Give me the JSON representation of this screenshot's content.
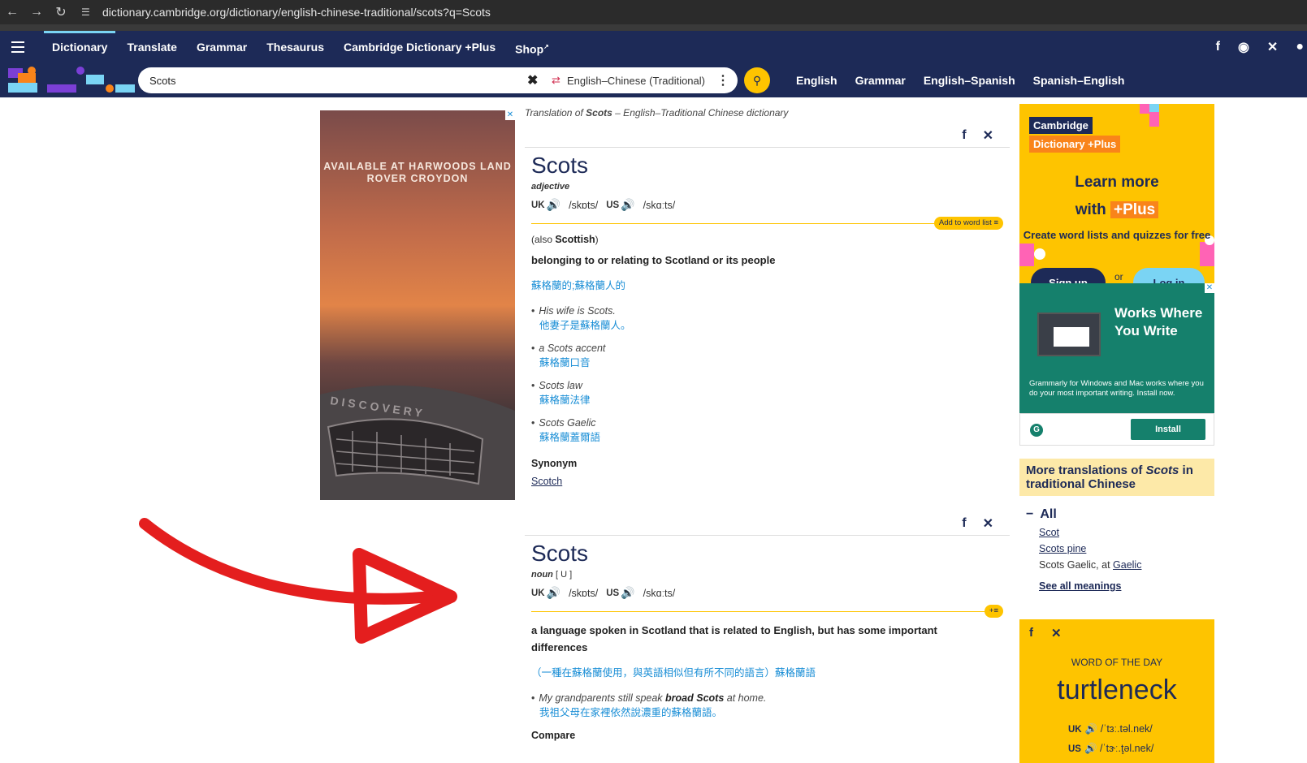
{
  "browser": {
    "url": "dictionary.cambridge.org/dictionary/english-chinese-traditional/scots?q=Scots"
  },
  "nav": {
    "items": [
      "Dictionary",
      "Translate",
      "Grammar",
      "Thesaurus",
      "Cambridge Dictionary +Plus",
      "Shop"
    ],
    "active": "Dictionary",
    "social": [
      "facebook-icon",
      "instagram-icon",
      "x-icon"
    ]
  },
  "search": {
    "query": "Scots",
    "dictionary": "English–Chinese (Traditional)",
    "quick_links": [
      "English",
      "Grammar",
      "English–Spanish",
      "Spanish–English"
    ]
  },
  "ad_left": {
    "text": "AVAILABLE AT HARWOODS LAND ROVER CROYDON",
    "brand": "DISCOVERY"
  },
  "entry": {
    "caption_prefix": "Translation of ",
    "caption_word": "Scots",
    "caption_suffix": " – English–Traditional Chinese dictionary",
    "blocks": [
      {
        "headword": "Scots",
        "pos": "adjective",
        "grammar": "",
        "uk_label": "UK",
        "uk_ipa": "/skɒts/",
        "us_label": "US",
        "us_ipa": "/skɑːts/",
        "wordlist_label": "Add to word list ≡",
        "also_prefix": "(also ",
        "also_word": "Scottish",
        "also_suffix": ")",
        "definition": "belonging to or relating to Scotland or its people",
        "translation": "蘇格蘭的;蘇格蘭人的",
        "examples": [
          {
            "text": "His wife is Scots.",
            "trans": "他妻子是蘇格蘭人。"
          },
          {
            "text": "a Scots accent",
            "trans": "蘇格蘭口音"
          },
          {
            "text": "Scots law",
            "trans": "蘇格蘭法律"
          },
          {
            "text": "Scots Gaelic",
            "trans": "蘇格蘭蓋爾語"
          }
        ],
        "synonym_heading": "Synonym",
        "synonym": "Scotch"
      },
      {
        "headword": "Scots",
        "pos": "noun",
        "grammar": "[ U ]",
        "uk_label": "UK",
        "uk_ipa": "/skɒts/",
        "us_label": "US",
        "us_ipa": "/skɑːts/",
        "wordlist_label": "+≡",
        "definition": "a language spoken in Scotland that is related to English, but has some important differences",
        "translation": "（一種在蘇格蘭使用，與英語相似但有所不同的語言）蘇格蘭語",
        "example_pre": "My grandparents still speak ",
        "example_bold": "broad Scots",
        "example_post": " at home.",
        "example_trans": "我祖父母在家裡依然說濃重的蘇格蘭語。",
        "compare_heading": "Compare"
      }
    ]
  },
  "sidebar": {
    "plus_ad": {
      "badge1": "Cambridge",
      "badge2": "Dictionary +Plus",
      "title_line1": "Learn more",
      "title_with": "with ",
      "title_plus": "+Plus",
      "subtitle": "Create word lists and quizzes for free",
      "signup": "Sign up",
      "or": "or",
      "login": "Log in"
    },
    "grammarly_ad": {
      "title": "Works Where You Write",
      "subtitle": "Grammarly for Windows and Mac works where you do your most important writing. Install now.",
      "install": "Install"
    },
    "more_translations": {
      "heading_pre": "More translations of ",
      "heading_word": "Scots",
      "heading_post": " in traditional Chinese",
      "all_label": "All",
      "items": [
        "Scot",
        "Scots pine"
      ],
      "gaelic_pre": "Scots Gaelic, at ",
      "gaelic_link": "Gaelic",
      "see_all": "See all meanings"
    },
    "wotd": {
      "label": "WORD OF THE DAY",
      "word": "turtleneck",
      "uk_label": "UK",
      "uk_ipa": "/ˈtɜː.təl.nek/",
      "us_label": "US",
      "us_ipa": "/ˈtɝː.t̥əl.nek/"
    }
  },
  "colors": {
    "navy": "#1d2a57",
    "yellow": "#fec400",
    "link_blue": "#1a8ed6",
    "annotation_red": "#e41e1e"
  }
}
